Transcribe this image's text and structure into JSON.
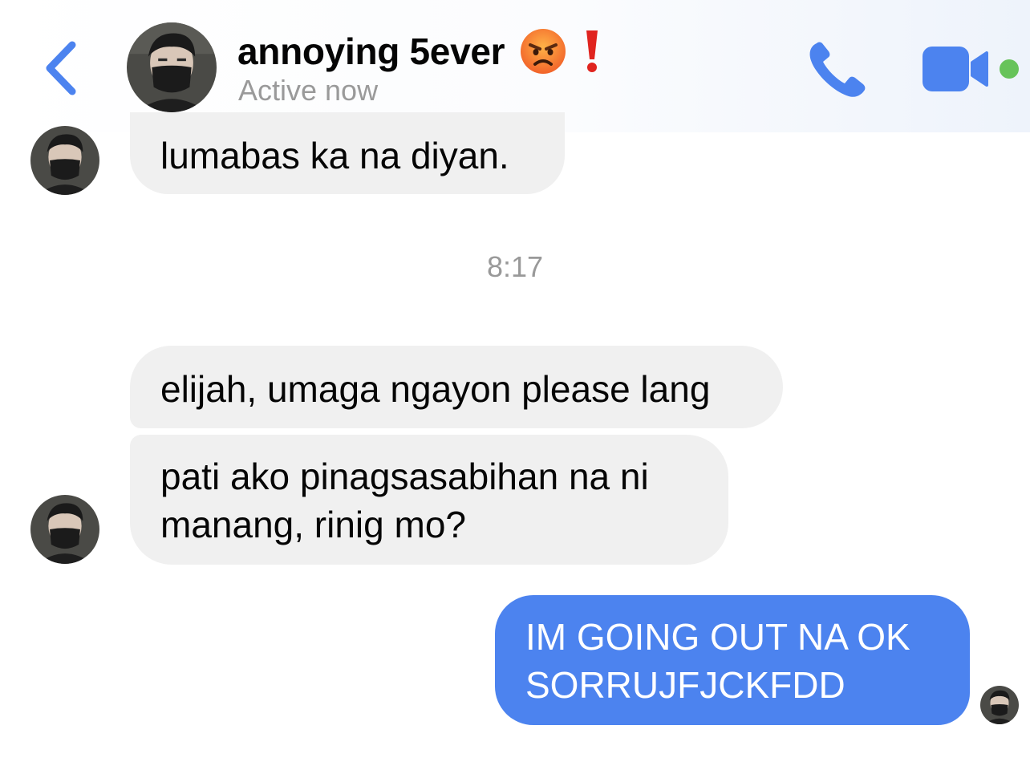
{
  "header": {
    "contact_name": "annoying 5ever",
    "status": "Active now",
    "name_emojis": [
      "angry-face",
      "red-exclamation-mark"
    ],
    "accent_color": "#4c83ef",
    "online_color": "#67c35a"
  },
  "messages": [
    {
      "direction": "incoming",
      "lines": [
        "lumabas ka na diyan."
      ]
    },
    {
      "type": "timestamp",
      "text": "8:17"
    },
    {
      "direction": "incoming",
      "lines": [
        "elijah, umaga ngayon please lang"
      ]
    },
    {
      "direction": "incoming",
      "lines": [
        "pati ako pinagsasabihan na ni",
        "manang, rinig mo?"
      ]
    },
    {
      "direction": "outgoing",
      "lines": [
        "IM GOING OUT NA OK",
        "SORRUJFJCKFDD"
      ],
      "bubble_color": "#4c83ef"
    }
  ]
}
